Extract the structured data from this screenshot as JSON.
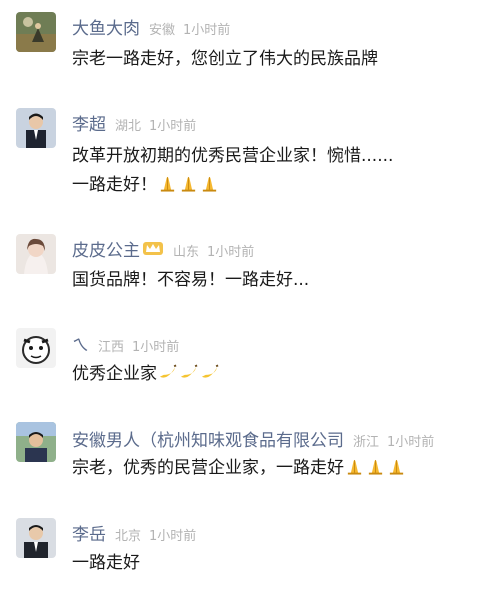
{
  "comments": [
    {
      "name": "大鱼大肉",
      "location": "安徽",
      "time": "1小时前",
      "text": "宗老一路走好，您创立了伟大的民族品牌"
    },
    {
      "name": "李超",
      "location": "湖北",
      "time": "1小时前",
      "text": "改革开放初期的优秀民营企业家！惋惜......",
      "text2": "一路走好！",
      "emoji": "folded-hands"
    },
    {
      "name": "皮皮公主",
      "location": "山东",
      "time": "1小时前",
      "text": "国货品牌！不容易！一路走好..."
    },
    {
      "name": "ㄟ",
      "location": "江西",
      "time": "1小时前",
      "text": "优秀企业家",
      "emoji": "banana"
    },
    {
      "name": "安徽男人（杭州知味观食品有限公司",
      "location": "浙江",
      "time": "1小时前",
      "text": "宗老，优秀的民营企业家，一路走好",
      "emoji": "folded-hands"
    },
    {
      "name": "李岳",
      "location": "北京",
      "time": "1小时前",
      "text": "一路走好"
    }
  ],
  "colors": {
    "name": "#5b6b8c",
    "meta": "#b3b3b3",
    "text": "#1a1a1a"
  }
}
